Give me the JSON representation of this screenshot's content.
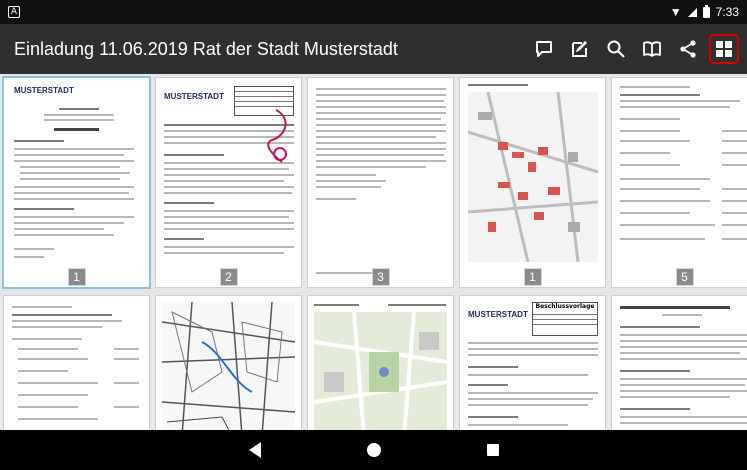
{
  "status": {
    "left_icon": "A",
    "time": "7:33"
  },
  "appbar": {
    "title": "Einladung 11.06.2019 Rat der Stadt Musterstadt",
    "actions": [
      {
        "icon": "comment-icon"
      },
      {
        "icon": "edit-icon"
      },
      {
        "icon": "search-icon"
      },
      {
        "icon": "book-icon"
      },
      {
        "icon": "share-icon"
      },
      {
        "icon": "grid-view-icon",
        "selected": true
      }
    ]
  },
  "pages": [
    {
      "badge": "1",
      "logo": "MUSTERSTADT"
    },
    {
      "badge": "2",
      "logo": "MUSTERSTADT"
    },
    {
      "badge": "3"
    },
    {
      "badge": "1"
    },
    {
      "badge": "5"
    },
    {},
    {},
    {},
    {
      "logo": "MUSTERSTADT",
      "label": "Beschlussvorlage"
    },
    {}
  ],
  "colors": {
    "accent": "#d20000",
    "appbar": "#2f2f2f",
    "logo": "#1a2c5a"
  }
}
